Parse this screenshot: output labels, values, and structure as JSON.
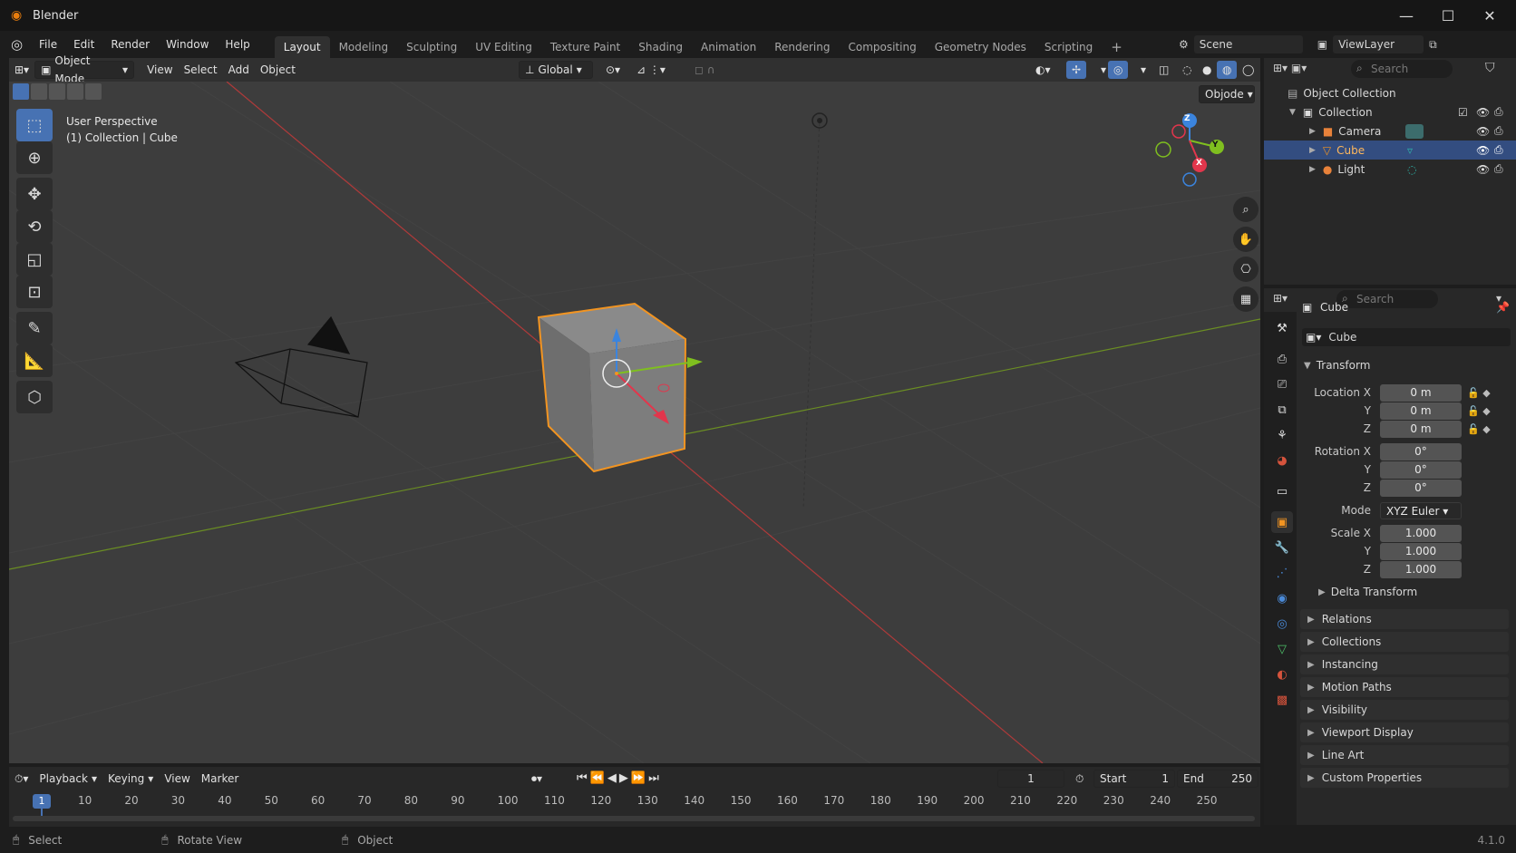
{
  "app": {
    "title": "Blender",
    "version": "4.1.0"
  },
  "menus": [
    "File",
    "Edit",
    "Render",
    "Window",
    "Help"
  ],
  "workspaces": [
    "Layout",
    "Modeling",
    "Sculpting",
    "UV Editing",
    "Texture Paint",
    "Shading",
    "Animation",
    "Rendering",
    "Compositing",
    "Geometry Nodes",
    "Scripting"
  ],
  "active_workspace": "Layout",
  "scene": {
    "name": "Scene",
    "view_layer": "ViewLayer"
  },
  "viewport": {
    "mode": "Object Mode",
    "menus": [
      "View",
      "Select",
      "Add",
      "Object"
    ],
    "orientation": "Global",
    "overlay_info": {
      "line1": "User Perspective",
      "line2": "(1) Collection | Cube"
    },
    "object_dropdown": "Objode",
    "gizmo_axes": [
      "X",
      "Y",
      "Z"
    ]
  },
  "outliner": {
    "search_placeholder": "Search",
    "root": "Object Collection",
    "collection": "Collection",
    "items": [
      {
        "name": "Camera",
        "selected": false
      },
      {
        "name": "Cube",
        "selected": true
      },
      {
        "name": "Light",
        "selected": false
      }
    ]
  },
  "properties": {
    "search_placeholder": "Search",
    "object_name": "Cube",
    "datablock_name": "Cube",
    "transform_title": "Transform",
    "location": {
      "label": "Location X",
      "x": "0 m",
      "y": "0 m",
      "z": "0 m"
    },
    "rotation": {
      "label": "Rotation X",
      "x": "0°",
      "y": "0°",
      "z": "0°"
    },
    "mode_label": "Mode",
    "mode_value": "XYZ Euler",
    "scale": {
      "label": "Scale X",
      "x": "1.000",
      "y": "1.000",
      "z": "1.000"
    },
    "axis_y": "Y",
    "axis_z": "Z",
    "delta_transform": "Delta Transform",
    "panels": [
      "Relations",
      "Collections",
      "Instancing",
      "Motion Paths",
      "Visibility",
      "Viewport Display",
      "Line Art",
      "Custom Properties"
    ]
  },
  "timeline": {
    "menus": [
      "Playback",
      "Keying",
      "View",
      "Marker"
    ],
    "current_frame": "1",
    "start_label": "Start",
    "start": "1",
    "end_label": "End",
    "end": "250",
    "ticks": [
      "10",
      "20",
      "30",
      "40",
      "50",
      "60",
      "70",
      "80",
      "90",
      "100",
      "110",
      "120",
      "130",
      "140",
      "150",
      "160",
      "170",
      "180",
      "190",
      "200",
      "210",
      "220",
      "230",
      "240",
      "250"
    ]
  },
  "statusbar": {
    "select": "Select",
    "rotate": "Rotate View",
    "object": "Object"
  },
  "colors": {
    "accent": "#4772b3",
    "selection_orange": "#f29421",
    "x_axis": "#e2364c",
    "y_axis": "#7fbf1f",
    "z_axis": "#3b84dd"
  }
}
